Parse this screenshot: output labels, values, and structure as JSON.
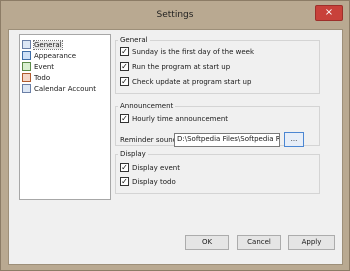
{
  "window": {
    "title": "Settings",
    "close_symbol": "×"
  },
  "sidebar": {
    "items": [
      {
        "label": "General",
        "icon": "general-icon"
      },
      {
        "label": "Appearance",
        "icon": "appearance-icon"
      },
      {
        "label": "Event",
        "icon": "event-icon"
      },
      {
        "label": "Todo",
        "icon": "todo-icon"
      },
      {
        "label": "Calendar Account",
        "icon": "calendar-account-icon"
      }
    ],
    "selected": "General"
  },
  "general": {
    "heading": "General",
    "options": [
      {
        "label": "Sunday is the first day of the week",
        "checked": true
      },
      {
        "label": "Run the program at start up",
        "checked": true
      },
      {
        "label": "Check update at program start up",
        "checked": true
      }
    ]
  },
  "announcement": {
    "heading": "Announcement",
    "hourly": {
      "label": "Hourly time announcement",
      "checked": true
    },
    "reminder_label": "Reminder sound",
    "reminder_value": "D:\\Softpedia Files\\Softpedia Radio",
    "browse_label": "..."
  },
  "display": {
    "heading": "Display",
    "options": [
      {
        "label": "Display event",
        "checked": true
      },
      {
        "label": "Display todo",
        "checked": true
      }
    ]
  },
  "buttons": {
    "ok": "OK",
    "cancel": "Cancel",
    "apply": "Apply"
  },
  "check_mark": "✓",
  "colors": {
    "close_button": "#c8413a",
    "frame": "#b9a991",
    "selection_outline": "#7a7a7a"
  }
}
